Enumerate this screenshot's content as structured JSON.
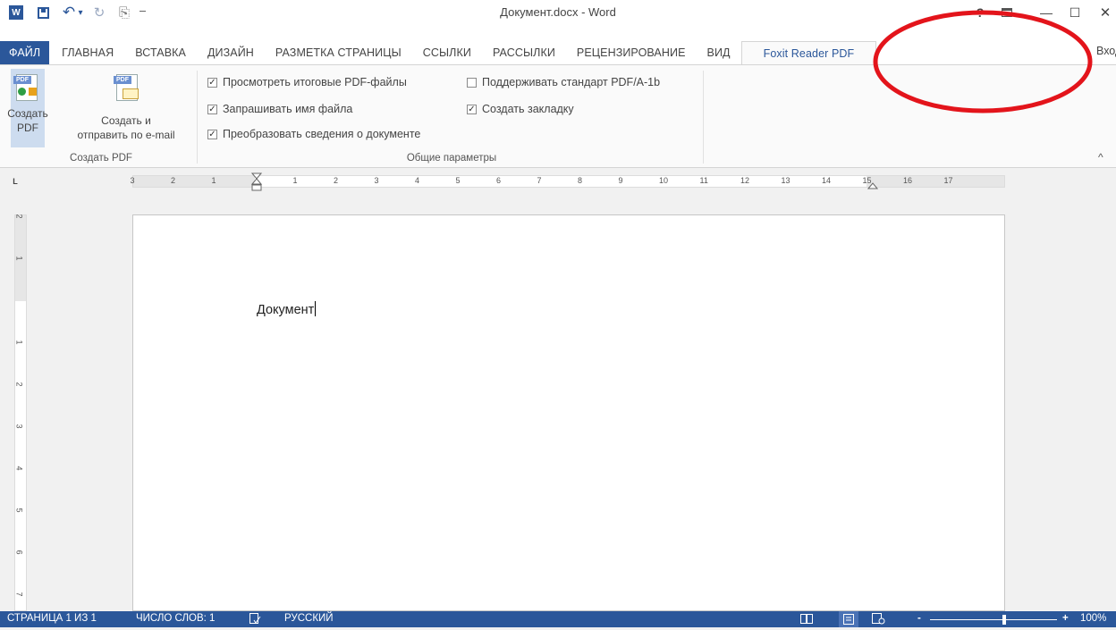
{
  "window": {
    "title": "Документ.docx - Word",
    "help_glyph": "?",
    "ribbon_display_glyph": "🗖",
    "minimize_glyph": "—",
    "maximize_glyph": "☐",
    "close_glyph": "✕"
  },
  "qat": {
    "app_icon_text": "W",
    "save_glyph": "🖫",
    "undo_glyph": "↶",
    "undo_dropdown_glyph": "▾",
    "redo_glyph": "↻",
    "touch_glyph": "⎘",
    "customize_glyph": "₹"
  },
  "tabs": [
    {
      "label": "ФАЙЛ",
      "kind": "file"
    },
    {
      "label": "ГЛАВНАЯ"
    },
    {
      "label": "ВСТАВКА"
    },
    {
      "label": "ДИЗАЙН"
    },
    {
      "label": "РАЗМЕТКА СТРАНИЦЫ"
    },
    {
      "label": "ССЫЛКИ"
    },
    {
      "label": "РАССЫЛКИ"
    },
    {
      "label": "РЕЦЕНЗИРОВАНИЕ"
    },
    {
      "label": "ВИД"
    },
    {
      "label": "Foxit Reader PDF",
      "kind": "active"
    }
  ],
  "signin": "Вход",
  "ribbon": {
    "create_pdf": {
      "line1": "Создать",
      "line2": "PDF"
    },
    "create_send": {
      "line1": "Создать и",
      "line2": "отправить по e-mail"
    },
    "group1_label": "Создать PDF",
    "group2_label": "Общие параметры",
    "options": [
      {
        "label": "Просмотреть итоговые PDF-файлы",
        "checked": true
      },
      {
        "label": "Запрашивать имя файла",
        "checked": true
      },
      {
        "label": "Преобразовать сведения о документе",
        "checked": true
      },
      {
        "label": "Поддерживать стандарт PDF/A-1b",
        "checked": false
      },
      {
        "label": "Создать закладку",
        "checked": true
      }
    ],
    "collapse_glyph": "^",
    "pdf_badge": "PDF"
  },
  "ruler": {
    "corner_glyph": "L",
    "h_labels": [
      "3",
      "2",
      "1",
      "1",
      "2",
      "3",
      "4",
      "5",
      "6",
      "7",
      "8",
      "9",
      "10",
      "11",
      "12",
      "13",
      "14",
      "15",
      "16",
      "17"
    ],
    "v_labels": [
      "2",
      "1",
      "1",
      "2",
      "3",
      "4",
      "5",
      "6",
      "7"
    ]
  },
  "document": {
    "text": "Документ"
  },
  "status": {
    "page": "СТРАНИЦА 1 ИЗ 1",
    "words": "ЧИСЛО СЛОВ: 1",
    "proof_glyph": "⎘",
    "language": "РУССКИЙ",
    "zoom_out": "-",
    "zoom_in": "+",
    "zoom_level": "100%",
    "zoom_fraction": 0.5
  },
  "colors": {
    "accent": "#2b579a",
    "annotation": "#e3141b"
  }
}
